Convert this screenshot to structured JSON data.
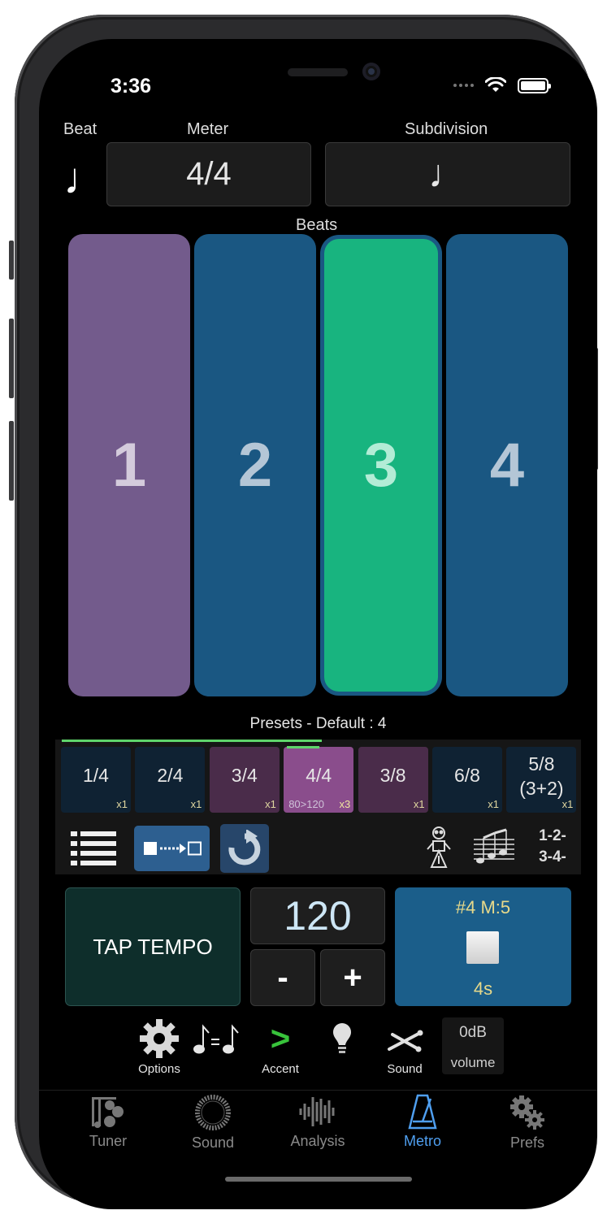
{
  "status": {
    "time": "3:36"
  },
  "header": {
    "beat_label": "Beat",
    "meter_label": "Meter",
    "subdivision_label": "Subdivision",
    "beat_value": "♩",
    "meter_value": "4/4",
    "subdivision_value": "♩"
  },
  "beats": {
    "label": "Beats",
    "items": [
      {
        "number": "1",
        "color": "#735b8c",
        "text_color": "#d4cbdc"
      },
      {
        "number": "2",
        "color": "#1a5782",
        "text_color": "#b4c6d6"
      },
      {
        "number": "3",
        "color": "#18b47f",
        "text_color": "#b3ecd6",
        "active": true
      },
      {
        "number": "4",
        "color": "#1a5782",
        "text_color": "#b4c6d6"
      }
    ]
  },
  "presets": {
    "title": "Presets - Default : 4",
    "items": [
      {
        "label": "1/4",
        "rep": "x1",
        "tempo": "",
        "color": "#0f2233"
      },
      {
        "label": "2/4",
        "rep": "x1",
        "tempo": "",
        "color": "#0f2233"
      },
      {
        "label": "3/4",
        "rep": "x1",
        "tempo": "",
        "color": "#4a2c4a"
      },
      {
        "label": "4/4",
        "rep": "x3",
        "tempo": "80>120",
        "color": "#8a4d8c"
      },
      {
        "label": "3/8",
        "rep": "x1",
        "tempo": "",
        "color": "#4a2c4a"
      },
      {
        "label": "6/8",
        "rep": "x1",
        "tempo": "",
        "color": "#0f2233"
      },
      {
        "label": "5/8 (3+2)",
        "line1": "5/8",
        "line2": "(3+2)",
        "rep": "x1",
        "tempo": "",
        "color": "#0f2233"
      }
    ]
  },
  "tools": {
    "count_label_1": "1-2-",
    "count_label_2": "3-4-"
  },
  "controls": {
    "tap_tempo": "TAP TEMPO",
    "tempo": "120",
    "minus": "-",
    "plus": "+",
    "play_top": "#4 M:5",
    "play_bottom": "4s"
  },
  "options": {
    "options_label": "Options",
    "accent_label": "Accent",
    "accent_symbol": ">",
    "sound_label": "Sound",
    "volume_value": "0dB",
    "volume_label": "volume"
  },
  "tabs": [
    {
      "label": "Tuner",
      "icon": "tuner-icon",
      "active": false
    },
    {
      "label": "Sound",
      "icon": "sound-icon",
      "active": false
    },
    {
      "label": "Analysis",
      "icon": "analysis-icon",
      "active": false
    },
    {
      "label": "Metro",
      "icon": "metronome-icon",
      "active": true
    },
    {
      "label": "Prefs",
      "icon": "gears-icon",
      "active": false
    }
  ]
}
